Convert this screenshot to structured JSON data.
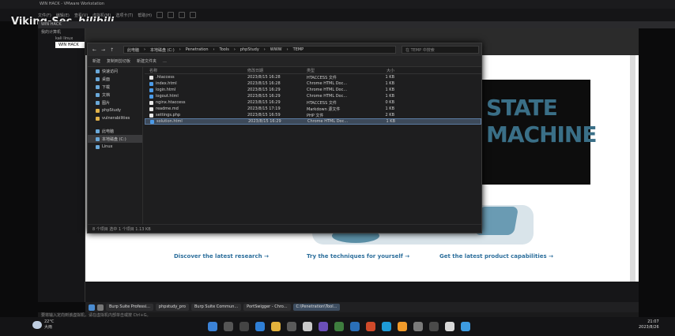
{
  "vmware": {
    "title": "WIN HACK - VMware Workstation",
    "menu_items": [
      "文件(F)",
      "编辑(E)",
      "查看(V)",
      "虚拟机(M)",
      "选项卡(T)",
      "帮助(H)"
    ],
    "tab": "WIN HACK",
    "library": {
      "title": "我的计算机",
      "items": [
        "kali linux",
        "WIN HACK"
      ]
    }
  },
  "watermark": {
    "prefix": "Viking-Sec",
    "logo": "bilibili"
  },
  "explorer": {
    "breadcrumb": [
      "此电脑",
      "本地磁盘 (C:)",
      "Penetration",
      "Tools",
      "phpStudy",
      "WWW",
      "TEMP"
    ],
    "search_placeholder": "在 TEMP 中搜索",
    "toolbar": [
      "新建",
      "复制到剪切板",
      "新建文件夹",
      "..."
    ],
    "sidebar": [
      {
        "label": "快速访问",
        "icon": "star-icon"
      },
      {
        "label": "桌面",
        "icon": "desktop-icon"
      },
      {
        "label": "下载",
        "icon": "download-icon"
      },
      {
        "label": "文档",
        "icon": "document-icon"
      },
      {
        "label": "图片",
        "icon": "picture-icon"
      },
      {
        "label": "phpStudy",
        "icon": "folder-icon"
      },
      {
        "label": "vulnerabilities",
        "icon": "folder-icon"
      },
      {
        "label": "此电脑",
        "icon": "computer-icon"
      },
      {
        "label": "本地磁盘 (C:)",
        "icon": "drive-icon"
      },
      {
        "label": "Linux",
        "icon": "linux-icon"
      }
    ],
    "columns": [
      "名称",
      "修改日期",
      "类型",
      "大小"
    ],
    "files": [
      {
        "name": ".htaccess",
        "date": "2023/8/15 16:28",
        "type": "HTACCESS 文件",
        "size": "1 KB"
      },
      {
        "name": "index.html",
        "date": "2023/8/15 16:28",
        "type": "Chrome HTML Doc...",
        "size": "1 KB"
      },
      {
        "name": "login.html",
        "date": "2023/8/15 16:29",
        "type": "Chrome HTML Doc...",
        "size": "1 KB"
      },
      {
        "name": "logout.html",
        "date": "2023/8/15 16:29",
        "type": "Chrome HTML Doc...",
        "size": "1 KB"
      },
      {
        "name": "nginx.htaccess",
        "date": "2023/8/15 16:29",
        "type": "HTACCESS 文件",
        "size": "0 KB"
      },
      {
        "name": "readme.md",
        "date": "2023/8/15 17:19",
        "type": "Markdown 源文件",
        "size": "1 KB"
      },
      {
        "name": "settings.php",
        "date": "2023/8/15 16:59",
        "type": "PHP 文件",
        "size": "2 KB"
      },
      {
        "name": "solution.html",
        "date": "2023/8/15 16:29",
        "type": "Chrome HTML Doc...",
        "size": "1 KB"
      }
    ],
    "status": "8 个项目  选中 1 个项目 1.13 KB"
  },
  "website": {
    "promo_text": "STATE MACHINE",
    "links": [
      "Discover the latest research",
      "Try the techniques for yourself",
      "Get the latest product capabilities"
    ]
  },
  "vm_taskbar": {
    "items": [
      "Burp Suite Professi...",
      "phpstudy_pro",
      "Burp Suite Commun...",
      "PortSwigger - Chro...",
      "C:\\Penetration\\Tool..."
    ],
    "status": "要将输入定向到该虚拟机，请在虚拟机内部单击或按 Ctrl+G。"
  },
  "host": {
    "weather_temp": "22°C",
    "weather_desc": "大雨",
    "time": "21:07",
    "date": "2023/8/26"
  }
}
